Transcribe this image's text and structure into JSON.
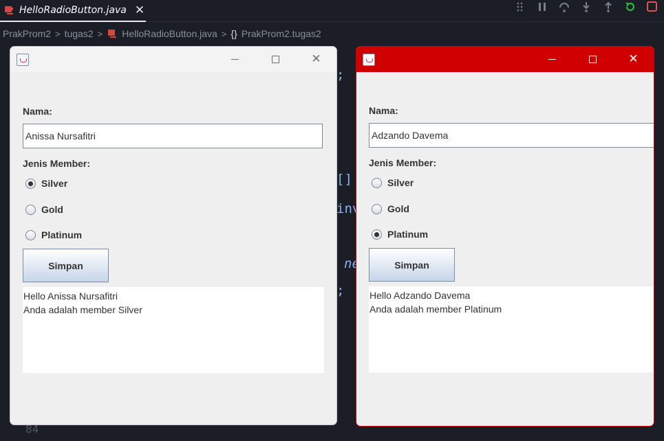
{
  "ide": {
    "tab_label": "HelloRadioButton.java",
    "tab_close": "✕",
    "breadcrumbs": [
      "PrakProm2",
      "tugas2",
      "HelloRadioButton.java",
      "PrakProm2.tugas2"
    ],
    "breadcrumb_sep": ">",
    "braces": "{}",
    "line_number": "84",
    "code_fragments": {
      "semi1": ";",
      "brackets": "[]",
      "inv": "inv",
      "ne": "ne",
      "semi2": ";"
    },
    "colors": {
      "accent_play": "#27c93f",
      "stop": "#e05252"
    }
  },
  "windows": [
    {
      "title_icon": "java-icon",
      "name_label": "Nama:",
      "name_value": "Anissa Nursafitri",
      "member_label": "Jenis Member:",
      "options": [
        "Silver",
        "Gold",
        "Platinum"
      ],
      "selected": "Silver",
      "button_label": "Simpan",
      "output_lines": [
        "Hello Anissa Nursafitri",
        "Anda adalah member Silver"
      ],
      "focused": false
    },
    {
      "title_icon": "java-icon",
      "name_label": "Nama:",
      "name_value": "Adzando Davema",
      "member_label": "Jenis Member:",
      "options": [
        "Silver",
        "Gold",
        "Platinum"
      ],
      "selected": "Platinum",
      "button_label": "Simpan",
      "output_lines": [
        "Hello Adzando Davema",
        "Anda adalah member Platinum"
      ],
      "focused": true,
      "colors": {
        "titlebar": "#d10000"
      }
    }
  ]
}
